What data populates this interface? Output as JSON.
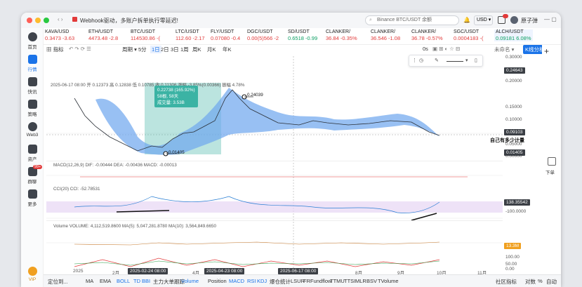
{
  "titlebar": {
    "tab_title": "Webhook驱动，多账户拆单执行零延迟!",
    "search_placeholder": "Binance BTC/USDT 余额",
    "currency": "USD",
    "username": "原子弹"
  },
  "sidebar": [
    {
      "label": "首页",
      "icon": "home-icon"
    },
    {
      "label": "行情",
      "icon": "chart-icon"
    },
    {
      "label": "快讯",
      "icon": "news-icon"
    },
    {
      "label": "策略",
      "icon": "strategy-icon"
    },
    {
      "label": "Web3",
      "icon": "web3-icon"
    },
    {
      "label": "资产",
      "icon": "wallet-icon"
    },
    {
      "label": "群聊",
      "icon": "chat-icon",
      "badge": "99+"
    },
    {
      "label": "更多",
      "icon": "more-icon"
    },
    {
      "label": "VIP",
      "icon": "vip-icon"
    }
  ],
  "tickers": [
    {
      "name": "KAVA/USD",
      "price": "0.3473",
      "change": "-3.63",
      "dir": "dn"
    },
    {
      "name": "ETH/USDT",
      "price": "4473.48",
      "change": "-2.8",
      "dir": "dn"
    },
    {
      "name": "BTC/USDT",
      "price": "114530.86",
      "change": "-(",
      "dir": "dn"
    },
    {
      "name": "LTC/USDT",
      "price": "112.60",
      "change": "-2.17",
      "dir": "dn"
    },
    {
      "name": "FLY/USDT",
      "price": "0.07080",
      "change": "-0.4",
      "dir": "dn"
    },
    {
      "name": "DGC/USDT",
      "price": "0.00(5)566",
      "change": "-2",
      "dir": "dn"
    },
    {
      "name": "SD/USDT",
      "price": "0.6518",
      "change": "-0.99",
      "dir": "up"
    },
    {
      "name": "CLANKER/",
      "price": "36.84",
      "change": "-0.35%",
      "dir": "dn"
    },
    {
      "name": "CLANKER/",
      "price": "36.546",
      "change": "-1.08",
      "dir": "dn"
    },
    {
      "name": "CLANKER/",
      "price": "36.78",
      "change": "-0.57%",
      "dir": "dn"
    },
    {
      "name": "SGC/USDT",
      "price": "0.0004183",
      "change": "-(",
      "dir": "dn"
    },
    {
      "name": "ALCH/USDT",
      "price": "0.09181",
      "change": "6.08%",
      "dir": "up"
    }
  ],
  "toolbar": {
    "indicator": "指标",
    "period": "周期",
    "periods": [
      "5分",
      "1日",
      "2日",
      "3日",
      "1周",
      "周K",
      "月K",
      "年K"
    ],
    "active_period": "1日",
    "zoom": "0s",
    "unnamed": "未命名",
    "kline": "K线分析"
  },
  "chart": {
    "ohlc_line": "2025-06-17 08:00  开 0.12373  高 0.12838  低 0.10785  收 0.11306  涨幅 -3.85%(0.00366)  振幅 4.78%",
    "tooltip": {
      "pct": "0.22738 (165.92%)",
      "bars": "58根, 58天",
      "vol": "成交量: 3.53B"
    },
    "low_label": "0.01405",
    "high_label": "0.24039",
    "macd": "MACD(12,26,9)  DIF: -0.00444  DEA: -0.00436  MACD: -0.00013",
    "cci": "CCI(20)  CCI: -52.78531",
    "volume": "Volume  VOLUME: 4,112,519.8600  MA(5): 5,047,281.8780  MA(10): 3,564,849.6650",
    "annotation": "自己有多少计量"
  },
  "price_axis": {
    "ticks": [
      "0.30000",
      "0.20000",
      "0.15000",
      "0.10000",
      "0.05000",
      "0.00000"
    ],
    "tags": [
      "0.24643",
      "0.09103",
      "0.01405"
    ],
    "cci_tag": "138.35542",
    "cci_ticks": [
      "-100.0000"
    ],
    "rsi_ticks": [
      "100.00",
      "50.00",
      "0.00"
    ],
    "vol_tag": "13.3M"
  },
  "time_axis": {
    "ticks": [
      "2025",
      "2月",
      "4月",
      "8月",
      "9月",
      "10月",
      "11月"
    ],
    "boxes": [
      "2025-02-24 08:00",
      "2025-04-23 08:00",
      "2025-06-17 08:00"
    ]
  },
  "bottombar": {
    "left": [
      "定位到...",
      "MA",
      "EMA",
      "BOLL",
      "TD",
      "BBI",
      "主力大单跟踪",
      "Volume",
      "Position",
      "MACD",
      "RSI",
      "KDJ",
      "爆仓统计",
      "LSUR",
      "FR",
      "Fundflow",
      "TTMU",
      "TTSI",
      "MLR",
      "BSV",
      "TVolume"
    ],
    "right": [
      "社区指标",
      "对数",
      "%",
      "自动"
    ]
  },
  "rightbar": {
    "label": "下单"
  }
}
